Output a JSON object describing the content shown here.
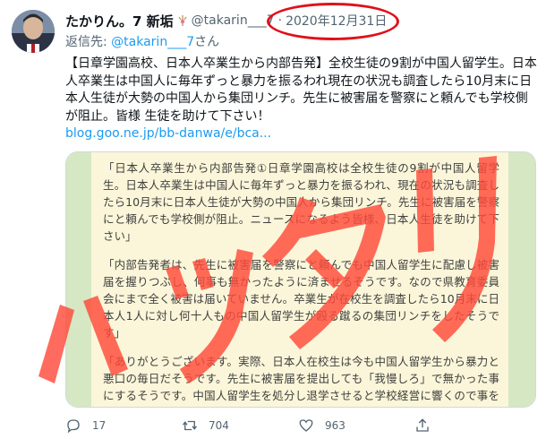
{
  "author": {
    "display_name": "たかりん。7 新垢",
    "handle": "@takarin___7",
    "date": "2020年12月31日"
  },
  "reply": {
    "prefix": "返信先:",
    "mention": "@takarin___7",
    "suffix": "さん"
  },
  "tweet": {
    "text": "【日章学園高校、日本人卒業生から内部告発】全校生徒の9割が中国人留学生。日本人卒業生は中国人に毎年ずっと暴力を振るわれ現在の状況も調査したら10月末に日本人生徒が大勢の中国人から集団リンチ。先生に被害届を警察にと頼んでも学校側が阻止。皆様 生徒を助けて下さい！",
    "link": "blog.goo.ne.jp/bb-danwa/e/bca..."
  },
  "card": {
    "paragraphs": [
      "「日本人卒業生から内部告発①日章学園高校は全校生徒の9割が中国人留学生。日本人卒業生は中国人に毎年ずっと暴力を振るわれ、現在の状況も調査したら10月末に日本人生徒が大勢の中国人から集団リンチ。先生に被害届を警察にと頼んでも学校側が阻止。ニュースになるよう皆様、日本人生徒を助けて下さい」",
      "「内部告発者は、先生に被害届を警察にと頼んでも中国人留学生に配慮し被害届を握りつぶし、何事も無かったように済ませるそうです。なので県教育委員会にまで全く被害は届いていません。卒業生が在校生を調査したら10月末に日本人1人に対し何十人もの中国人留学生が殴る蹴るの集団リンチをしたそうです」",
      "「ありがとうございます。実際、日本人在校生は今も中国人留学生から暴力と悪口の毎日だそうです。先生に被害届を提出しても「我慢しろ」で無かった事にするそうです。中国人留学生を処分し退学させると学校経営に響くので事を荒立てたくないのでしょう。何とか第三者の調査機関が入って助けて欲しいです」"
    ]
  },
  "watermark": {
    "text": "ハッタリ",
    "color": "#ff4b3a"
  },
  "highlight_color": "#e0101a",
  "actions": {
    "replies": "17",
    "retweets": "704",
    "likes": "963"
  }
}
